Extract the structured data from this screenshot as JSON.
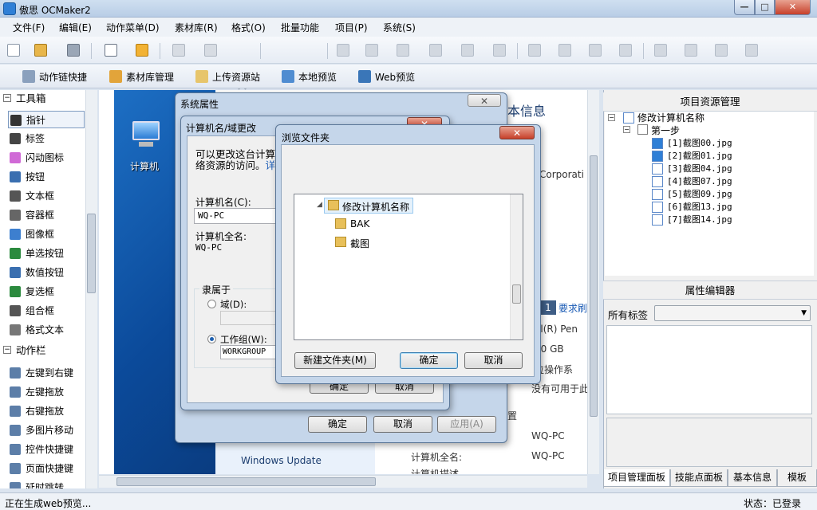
{
  "app": {
    "title": "傲思 OCMaker2"
  },
  "window_controls": {
    "minimize": "—",
    "maximize": "□",
    "close": "✕"
  },
  "menu": [
    "文件(F)",
    "编辑(E)",
    "动作菜单(D)",
    "素材库(R)",
    "格式(O)",
    "批量功能",
    "项目(P)",
    "系统(S)"
  ],
  "toolbar2": [
    {
      "label": "动作链快捷",
      "icon": "action-chain-icon"
    },
    {
      "label": "素材库管理",
      "icon": "library-icon"
    },
    {
      "label": "上传资源站",
      "icon": "upload-icon"
    },
    {
      "label": "本地预览",
      "icon": "monitor-icon"
    },
    {
      "label": "Web预览",
      "icon": "web-preview-icon"
    }
  ],
  "toolbox": {
    "title": "工具箱",
    "items": [
      {
        "label": "指针",
        "icon": "pointer-icon"
      },
      {
        "label": "标签",
        "icon": "label-icon"
      },
      {
        "label": "闪动图标",
        "icon": "flash-icon"
      },
      {
        "label": "按钮",
        "icon": "button-icon"
      },
      {
        "label": "文本框",
        "icon": "textbox-icon"
      },
      {
        "label": "容器框",
        "icon": "container-icon"
      },
      {
        "label": "图像框",
        "icon": "image-icon"
      },
      {
        "label": "单选按钮",
        "icon": "radio-icon"
      },
      {
        "label": "数值按钮",
        "icon": "numeric-icon"
      },
      {
        "label": "复选框",
        "icon": "checkbox-icon"
      },
      {
        "label": "组合框",
        "icon": "combo-icon"
      },
      {
        "label": "格式文本",
        "icon": "richtext-icon"
      }
    ]
  },
  "actionbar": {
    "title": "动作栏",
    "items": [
      {
        "label": "左键到右键",
        "icon": "mouse-icon"
      },
      {
        "label": "左键拖放",
        "icon": "drag-icon"
      },
      {
        "label": "右键拖放",
        "icon": "drag-icon"
      },
      {
        "label": "多图片移动",
        "icon": "images-icon"
      },
      {
        "label": "控件快捷键",
        "icon": "keyboard-icon"
      },
      {
        "label": "页面快捷键",
        "icon": "keyboard-icon"
      },
      {
        "label": "延时跳转",
        "icon": "timer-icon"
      }
    ]
  },
  "canvas": {
    "desktop_icon_label": "计算机",
    "bg_title": "本信息",
    "bg_corp": "Corporati",
    "bg_req": "要求刷",
    "bg_cpu": "el(R) Pen",
    "bg_mem": "00 GB",
    "bg_os": "位操作系",
    "bg_pen": "没有可用于此",
    "bg_settings": "置",
    "bg_windows_update": "Windows Update",
    "bg_computer_fullname_label": "计算机全名:",
    "bg_computer_name_value": "WQ-PC",
    "bg_computer_fullname_value": "WQ-PC",
    "bg_computer_desc": "计算机描述"
  },
  "sys_props": {
    "title": "系统属性",
    "ok": "确定",
    "cancel": "取消",
    "apply": "应用(A)"
  },
  "rename_dlg": {
    "title": "计算机名/域更改",
    "desc_line1": "可以更改这台计算机",
    "desc_line2": "络资源的访问。",
    "desc_link": "详",
    "name_label": "计算机名(C):",
    "name_value": "WQ-PC",
    "fullname_label": "计算机全名:",
    "fullname_value": "WQ-PC",
    "member_of": "隶属于",
    "domain_label": "域(D):",
    "workgroup_label": "工作组(W):",
    "workgroup_value": "WORKGROUP",
    "ok": "确定",
    "cancel": "取消"
  },
  "browse_dlg": {
    "title": "浏览文件夹",
    "tree": [
      {
        "label": "修改计算机名称",
        "level": 0,
        "expanded": true
      },
      {
        "label": "BAK",
        "level": 1
      },
      {
        "label": "截图",
        "level": 1
      }
    ],
    "new_folder": "新建文件夹(M)",
    "ok": "确定",
    "cancel": "取消"
  },
  "project_panel": {
    "title": "项目资源管理",
    "root": "修改计算机名称",
    "step": "第一步",
    "files": [
      "[1]截图00.jpg",
      "[2]截图01.jpg",
      "[3]截图04.jpg",
      "[4]截图07.jpg",
      "[5]截图09.jpg",
      "[6]截图13.jpg",
      "[7]截图14.jpg"
    ]
  },
  "prop_editor": {
    "title": "属性编辑器",
    "tag_label": "所有标签",
    "tag_value": ""
  },
  "bottom_tabs": [
    "项目管理面板",
    "技能点面板",
    "基本信息",
    "模板"
  ],
  "status": {
    "left": "正在生成web预览...",
    "right": "状态：已登录"
  },
  "colors": {
    "accent": "#2f7fd6",
    "desktop_blue": "#0b4a9a",
    "close_red": "#c7402a"
  }
}
